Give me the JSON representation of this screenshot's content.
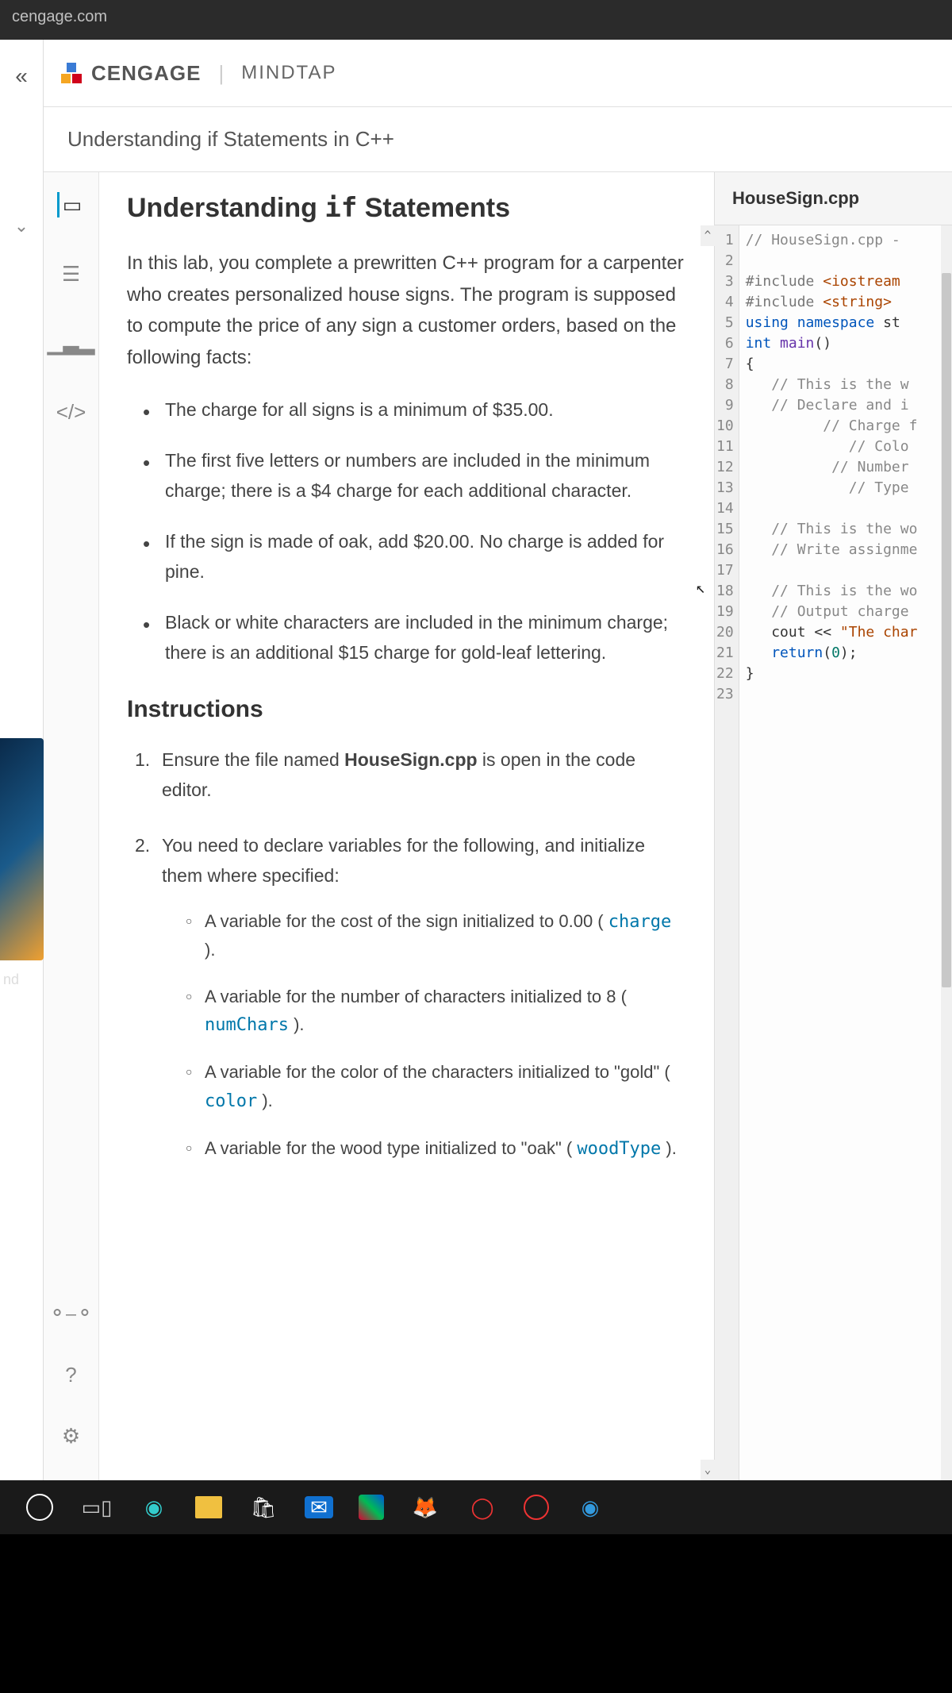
{
  "browser": {
    "url": "cengage.com"
  },
  "brand": {
    "name": "CENGAGE",
    "product": "MINDTAP"
  },
  "page": {
    "subtitle": "Understanding if Statements in C++"
  },
  "side": {
    "label": "nd"
  },
  "lesson": {
    "title_pre": "Understanding ",
    "title_code": "if",
    "title_post": " Statements",
    "intro": "In this lab, you complete a prewritten C++ program for a carpenter who creates personalized house signs. The program is supposed to compute the price of any sign a customer orders, based on the following facts:",
    "bullets": [
      "The charge for all signs is a minimum of $35.00.",
      "The first five letters or numbers are included in the minimum charge; there is a $4 charge for each additional character.",
      "If the sign is made of oak, add $20.00. No charge is added for pine.",
      "Black or white characters are included in the minimum charge; there is an additional $15 charge for gold-leaf lettering."
    ],
    "instructions_heading": "Instructions",
    "steps": [
      {
        "text_a": "Ensure the file named ",
        "bold": "HouseSign.cpp",
        "text_b": " is open in the code editor."
      },
      {
        "text_a": "You need to declare variables for the following, and initialize them where specified:",
        "bold": "",
        "text_b": ""
      }
    ],
    "subitems": [
      {
        "t1": "A variable for the cost of the sign initialized to 0.00 ( ",
        "code": "charge",
        "t2": " )."
      },
      {
        "t1": "A variable for the number of characters initialized to 8 ( ",
        "code": "numChars",
        "t2": " )."
      },
      {
        "t1": "A variable for the color of the characters initialized to \"gold\" ( ",
        "code": "color",
        "t2": " )."
      },
      {
        "t1": "A variable for the wood type initialized to \"oak\" ( ",
        "code": "woodType",
        "t2": " )."
      }
    ]
  },
  "code": {
    "filename": "HouseSign.cpp",
    "lines": [
      {
        "n": 1,
        "html": "<span class='c-cmt'>// HouseSign.cpp -</span>"
      },
      {
        "n": 2,
        "html": ""
      },
      {
        "n": 3,
        "html": "<span class='c-pp'>#include</span> <span class='c-str'>&lt;iostream</span>"
      },
      {
        "n": 4,
        "html": "<span class='c-pp'>#include</span> <span class='c-str'>&lt;string&gt;</span>"
      },
      {
        "n": 5,
        "html": "<span class='c-kw'>using</span> <span class='c-kw'>namespace</span> st"
      },
      {
        "n": 6,
        "html": "<span class='c-kw'>int</span> <span class='c-fn'>main</span>()"
      },
      {
        "n": 7,
        "html": "{"
      },
      {
        "n": 8,
        "html": "   <span class='c-cmt'>// This is the w</span>"
      },
      {
        "n": 9,
        "html": "   <span class='c-cmt'>// Declare and i</span>"
      },
      {
        "n": 10,
        "html": "         <span class='c-cmt'>// Charge f</span>"
      },
      {
        "n": 11,
        "html": "            <span class='c-cmt'>// Colo</span>"
      },
      {
        "n": 12,
        "html": "          <span class='c-cmt'>// Number</span>"
      },
      {
        "n": 13,
        "html": "            <span class='c-cmt'>// Type</span>"
      },
      {
        "n": 14,
        "html": ""
      },
      {
        "n": 15,
        "html": "   <span class='c-cmt'>// This is the wo</span>"
      },
      {
        "n": 16,
        "html": "   <span class='c-cmt'>// Write assignme</span>"
      },
      {
        "n": 17,
        "html": ""
      },
      {
        "n": 18,
        "html": "   <span class='c-cmt'>// This is the wo</span>"
      },
      {
        "n": 19,
        "html": "   <span class='c-cmt'>// Output charge</span>"
      },
      {
        "n": 20,
        "html": "   cout &lt;&lt; <span class='c-str'>\"The char</span>"
      },
      {
        "n": 21,
        "html": "   <span class='c-kw'>return</span>(<span class='c-num'>0</span>);"
      },
      {
        "n": 22,
        "html": "}"
      },
      {
        "n": 23,
        "html": ""
      }
    ]
  }
}
